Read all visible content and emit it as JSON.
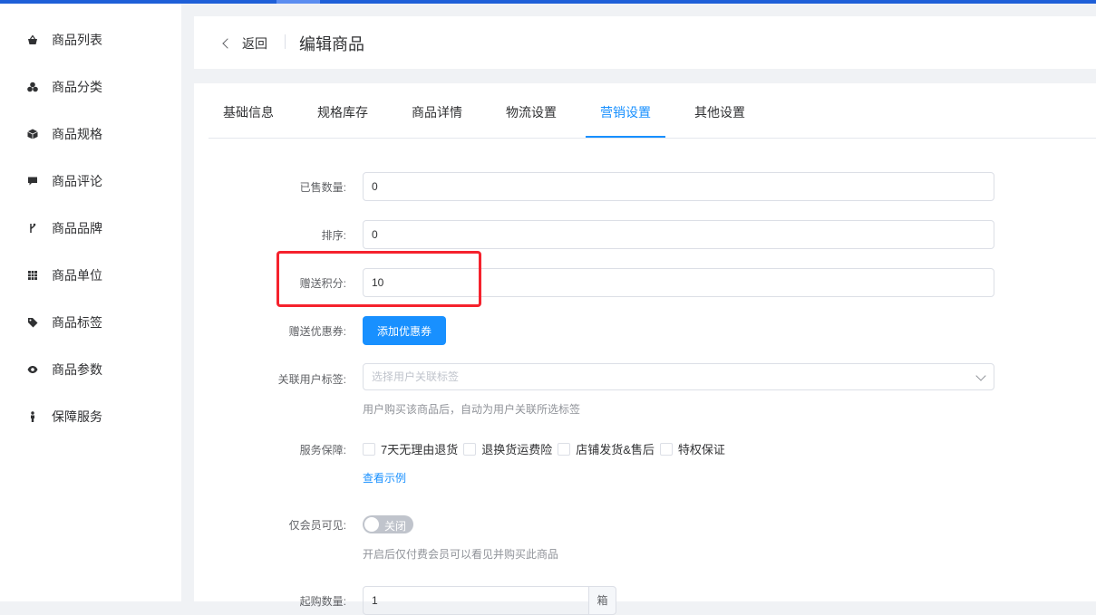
{
  "sidebar": {
    "items": [
      {
        "label": "商品列表",
        "icon": "shopping-basket-icon"
      },
      {
        "label": "商品分类",
        "icon": "category-cluster-icon"
      },
      {
        "label": "商品规格",
        "icon": "cube-icon"
      },
      {
        "label": "商品评论",
        "icon": "comment-icon"
      },
      {
        "label": "商品品牌",
        "icon": "branch-icon"
      },
      {
        "label": "商品单位",
        "icon": "grid-icon"
      },
      {
        "label": "商品标签",
        "icon": "tag-icon"
      },
      {
        "label": "商品参数",
        "icon": "eye-icon"
      },
      {
        "label": "保障服务",
        "icon": "person-icon"
      }
    ]
  },
  "header": {
    "back_label": "返回",
    "title": "编辑商品"
  },
  "tabs": [
    {
      "label": "基础信息",
      "active": false
    },
    {
      "label": "规格库存",
      "active": false
    },
    {
      "label": "商品详情",
      "active": false
    },
    {
      "label": "物流设置",
      "active": false
    },
    {
      "label": "营销设置",
      "active": true
    },
    {
      "label": "其他设置",
      "active": false
    }
  ],
  "form": {
    "sold_qty": {
      "label": "已售数量:",
      "value": "0"
    },
    "sort": {
      "label": "排序:",
      "value": "0"
    },
    "gift_points": {
      "label": "赠送积分:",
      "value": "10"
    },
    "gift_coupon": {
      "label": "赠送优惠券:",
      "button": "添加优惠券"
    },
    "user_tags": {
      "label": "关联用户标签:",
      "placeholder": "选择用户关联标签",
      "hint": "用户购买该商品后，自动为用户关联所选标签"
    },
    "service": {
      "label": "服务保障:",
      "options": [
        "7天无理由退货",
        "退换货运费险",
        "店铺发货&售后",
        "特权保证"
      ],
      "link": "查看示例"
    },
    "member_only": {
      "label": "仅会员可见:",
      "switch_text": "关闭",
      "hint": "开启后仅付费会员可以看见并购买此商品"
    },
    "min_qty": {
      "label": "起购数量:",
      "value": "1",
      "unit": "箱"
    }
  },
  "colors": {
    "primary": "#1890ff",
    "highlight": "#f5222d",
    "topbar": "#1e5fd8"
  }
}
